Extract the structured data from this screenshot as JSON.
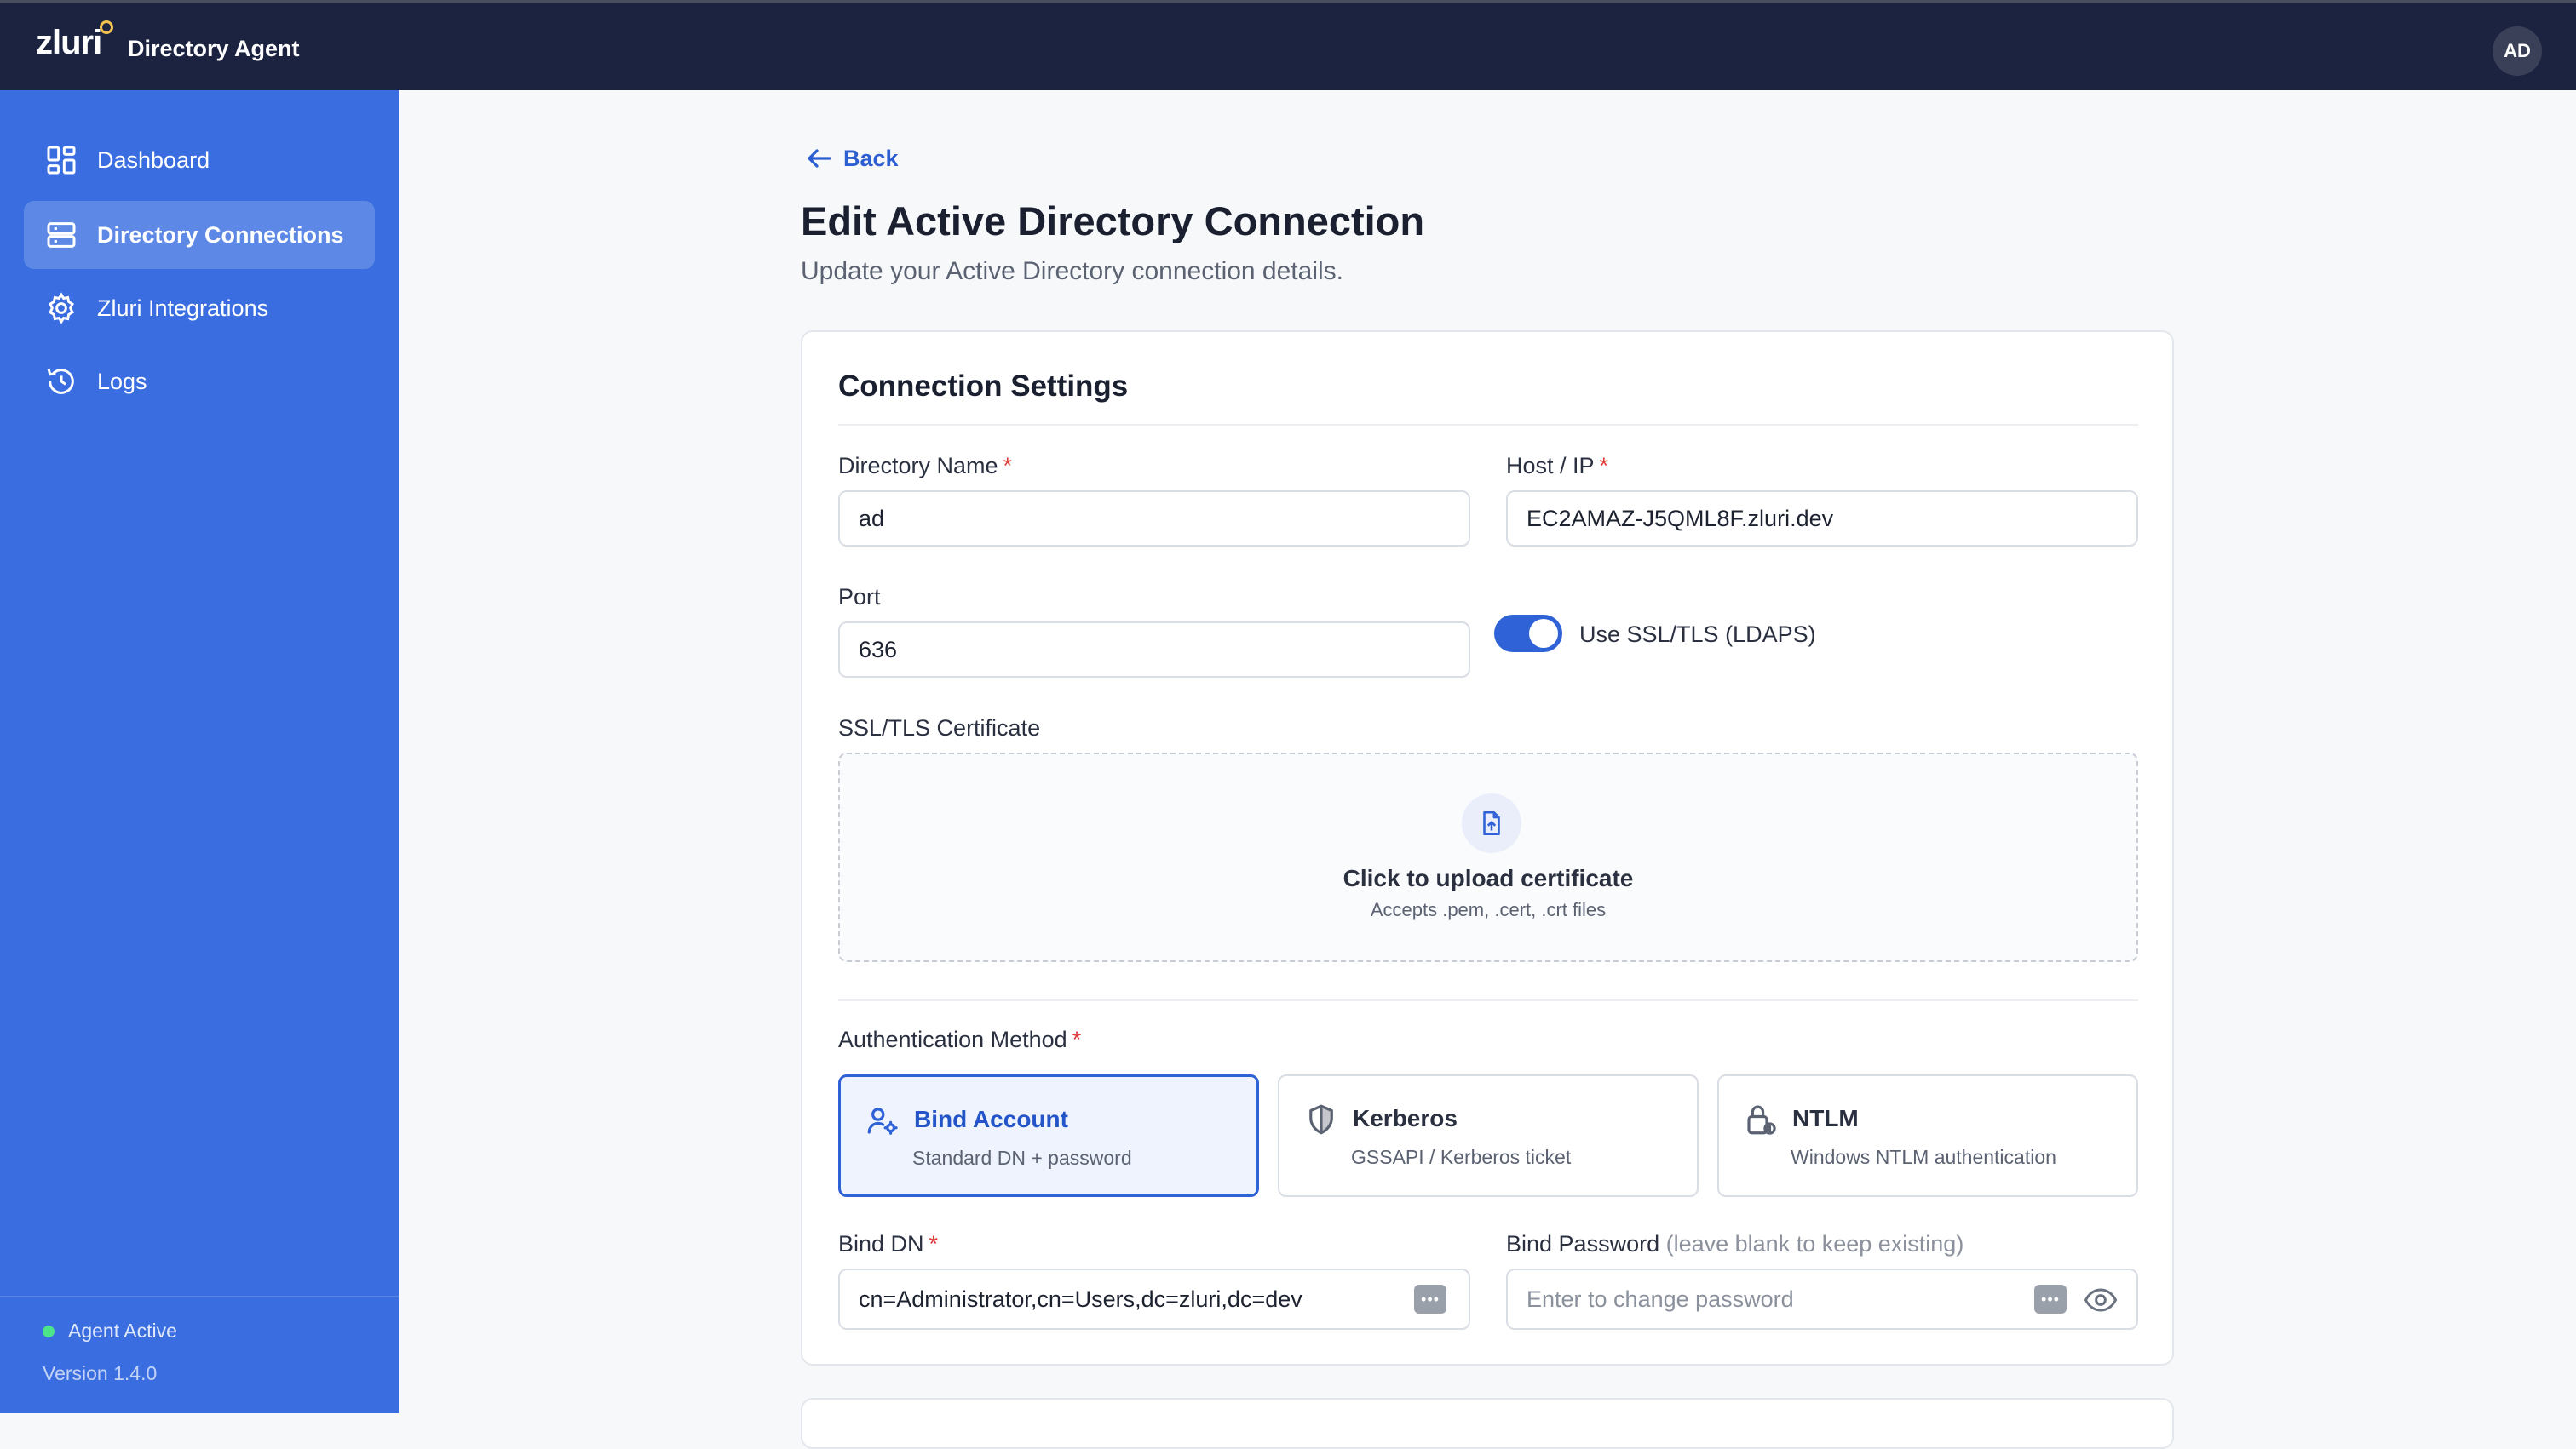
{
  "topbar": {
    "logo": "zluri",
    "app_name": "Directory Agent",
    "avatar": "AD"
  },
  "sidebar": {
    "items": [
      {
        "label": "Dashboard",
        "icon": "dashboard-icon"
      },
      {
        "label": "Directory Connections",
        "icon": "server-icon",
        "active": true
      },
      {
        "label": "Zluri Integrations",
        "icon": "gear-icon"
      },
      {
        "label": "Logs",
        "icon": "history-icon"
      }
    ],
    "status": "Agent Active",
    "version": "Version 1.4.0"
  },
  "page": {
    "back": "Back",
    "title": "Edit Active Directory Connection",
    "subtitle": "Update your Active Directory connection details."
  },
  "form": {
    "section_title": "Connection Settings",
    "directory_name": {
      "label": "Directory Name",
      "required": "*",
      "value": "ad"
    },
    "host": {
      "label": "Host / IP",
      "required": "*",
      "value": "EC2AMAZ-J5QML8F.zluri.dev"
    },
    "port": {
      "label": "Port",
      "value": "636"
    },
    "ssl_toggle": {
      "label": "Use SSL/TLS (LDAPS)",
      "on": true
    },
    "certificate": {
      "label": "SSL/TLS Certificate",
      "title": "Click to upload certificate",
      "subtitle": "Accepts .pem, .cert, .crt files"
    },
    "auth": {
      "label": "Authentication Method",
      "required": "*",
      "methods": [
        {
          "title": "Bind Account",
          "subtitle": "Standard DN + password",
          "icon": "user-gear-icon",
          "selected": true
        },
        {
          "title": "Kerberos",
          "subtitle": "GSSAPI / Kerberos ticket",
          "icon": "shield-icon"
        },
        {
          "title": "NTLM",
          "subtitle": "Windows NTLM authentication",
          "icon": "lock-icon"
        }
      ]
    },
    "bind_dn": {
      "label": "Bind DN",
      "required": "*",
      "value": "cn=Administrator,cn=Users,dc=zluri,dc=dev"
    },
    "bind_password": {
      "label": "Bind Password",
      "hint": "(leave blank to keep existing)",
      "placeholder": "Enter to change password"
    }
  },
  "colors": {
    "sidebar": "#3a6ee0",
    "topbar": "#1c2340",
    "accent": "#2f62d6",
    "required": "#e03a3a"
  }
}
